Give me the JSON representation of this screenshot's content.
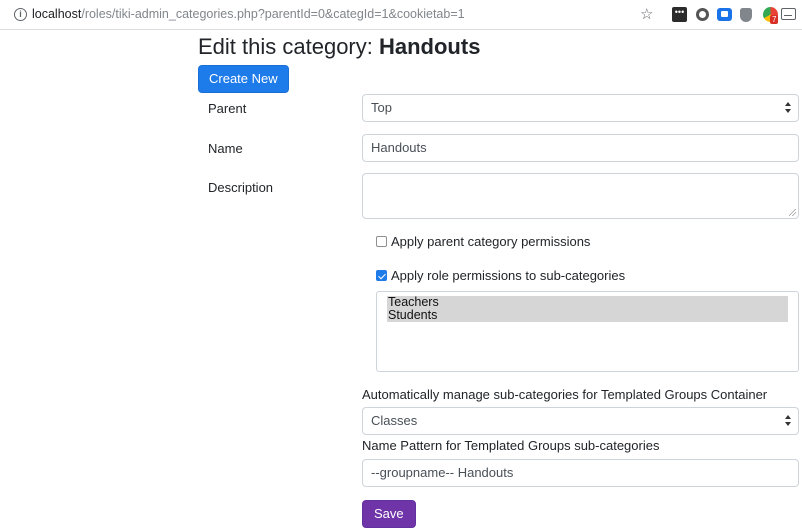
{
  "browser": {
    "url_host": "localhost",
    "url_path": "/roles/tiki-admin_categories.php?parentId=0&categId=1&cookietab=1",
    "extension_badge": "7"
  },
  "page": {
    "title_prefix": "Edit this category: ",
    "title_name": "Handouts",
    "create_button": "Create New",
    "save_button": "Save"
  },
  "form": {
    "parent_label": "Parent",
    "parent_value": "Top",
    "name_label": "Name",
    "name_value": "Handouts",
    "description_label": "Description",
    "description_value": "",
    "apply_parent_perms_label": "Apply parent category permissions",
    "apply_parent_perms_checked": false,
    "apply_role_perms_label": "Apply role permissions to sub-categories",
    "apply_role_perms_checked": true,
    "roles": [
      "Teachers",
      "Students"
    ],
    "auto_manage_label": "Automatically manage sub-categories for Templated Groups Container",
    "auto_manage_value": "Classes",
    "name_pattern_label": "Name Pattern for Templated Groups sub-categories",
    "name_pattern_value": "--groupname-- Handouts"
  },
  "colors": {
    "primary": "#1e7bea",
    "save": "#6f34a8"
  }
}
